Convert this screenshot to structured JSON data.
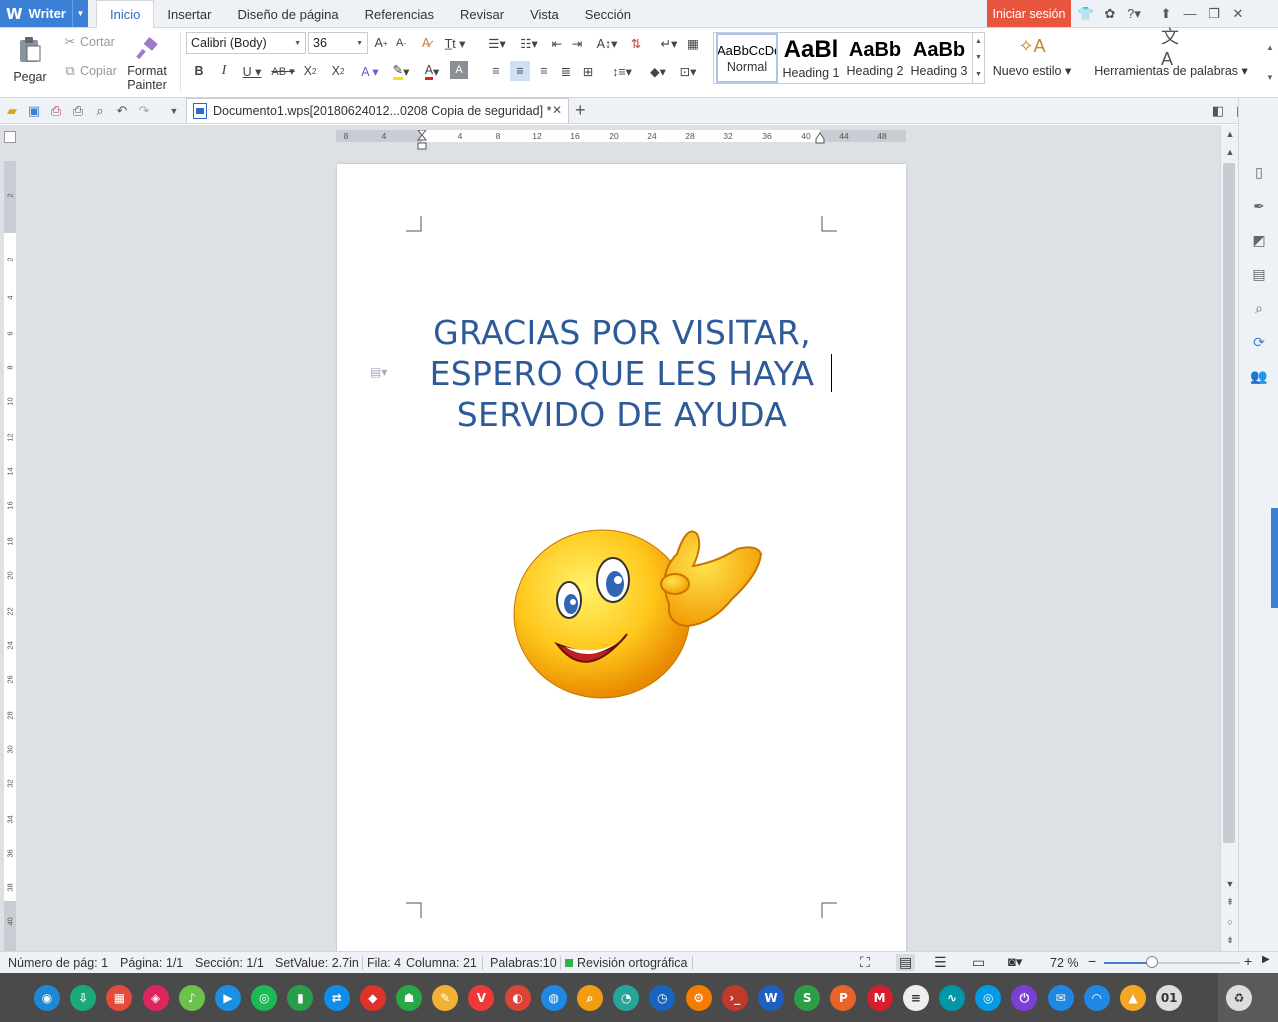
{
  "app": {
    "name": "Writer",
    "login_label": "Iniciar sesión"
  },
  "menu": {
    "tabs": [
      "Inicio",
      "Insertar",
      "Diseño de página",
      "Referencias",
      "Revisar",
      "Vista",
      "Sección"
    ]
  },
  "ribbon": {
    "paste_label": "Pegar",
    "cut_label": "Cortar",
    "copy_label": "Copiar",
    "format_painter_line1": "Format",
    "format_painter_line2": "Painter",
    "font_name": "Calibri (Body)",
    "font_size": "36",
    "styles": [
      {
        "sample": "AaBbCcDd",
        "label": "Normal"
      },
      {
        "sample": "AaBl",
        "label": "Heading 1"
      },
      {
        "sample": "AaBb",
        "label": "Heading 2"
      },
      {
        "sample": "AaBb",
        "label": "Heading 3"
      }
    ],
    "new_style_label": "Nuevo estilo",
    "word_tools_label": "Herramientas de palabras"
  },
  "document_tab": {
    "title": "Documento1.wps[20180624012...0208 Copia de seguridad] *"
  },
  "ruler": {
    "h_numbers": [
      "8",
      "4",
      "4",
      "8",
      "12",
      "16",
      "20",
      "24",
      "28",
      "32",
      "36",
      "40",
      "44",
      "48"
    ],
    "v_numbers": [
      "2",
      "2",
      "4",
      "6",
      "8",
      "10",
      "12",
      "14",
      "16",
      "18",
      "20",
      "22",
      "24",
      "26",
      "28",
      "30",
      "32",
      "34",
      "36",
      "38",
      "40"
    ]
  },
  "document": {
    "line1": "GRACIAS POR VISITAR,",
    "line2": "ESPERO QUE LES HAYA",
    "line3": "SERVIDO DE AYUDA",
    "text_color": "#2d5b9a"
  },
  "status": {
    "page_number": "Número de pág: 1",
    "page": "Página: 1/1",
    "section": "Sección: 1/1",
    "setvalue": "SetValue: 2.7in",
    "row": "Fila: 4",
    "column": "Columna: 21",
    "words": "Palabras:10",
    "spell": "Revisión ortográfica",
    "zoom": "72 %",
    "zoom_fraction": 0.35
  },
  "taskbar": {
    "icons": [
      "deepin-icon",
      "store-icon",
      "multitask-icon",
      "app-icon",
      "music-icon",
      "video-icon",
      "spotify-icon",
      "terminal-green-icon",
      "teamviewer-icon",
      "anydesk-icon",
      "android-icon",
      "paint-icon",
      "vivaldi-icon",
      "chrome-icon",
      "browser-icon",
      "search-icon",
      "files-icon",
      "clock-icon",
      "settings-icon",
      "terminal-icon",
      "wps-writer-icon",
      "wps-spreadsheet-icon",
      "wps-presentation-icon",
      "mega-icon",
      "notes-icon",
      "monitor-icon",
      "screenshot-icon",
      "power-icon",
      "mail-icon",
      "network-icon",
      "update-icon",
      "sound-icon",
      "trash-icon"
    ],
    "tray_text": "01"
  },
  "colors": {
    "accent": "#3c7fd6",
    "login": "#e8553e",
    "taskbar": "#4a4a4a"
  }
}
